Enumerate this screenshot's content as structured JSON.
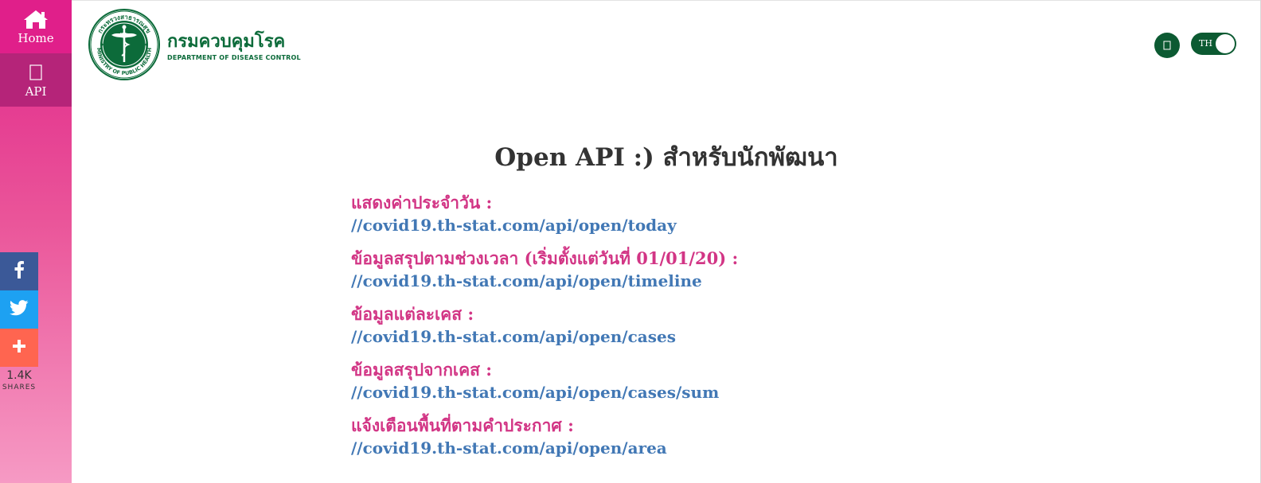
{
  "sidebar": {
    "items": [
      {
        "label": "Home",
        "icon": "home-icon"
      },
      {
        "label": "API",
        "icon": "code-icon"
      }
    ]
  },
  "header": {
    "logo": {
      "thai_name": "กรมควบคุมโรค",
      "english_name": "DEPARTMENT OF DISEASE CONTROL",
      "seal_text_top": "กระทรวงสาธารณสุข",
      "seal_text_bottom": "MINISTRY OF PUBLIC HEALTH"
    },
    "language_toggle": "TH"
  },
  "share": {
    "count": "1.4K",
    "label": "SHARES"
  },
  "main": {
    "title": "Open API :) สำหรับนักพัฒนา",
    "endpoints": [
      {
        "label": "แสดงค่าประจำวัน :",
        "url": "//covid19.th-stat.com/api/open/today"
      },
      {
        "label": "ข้อมูลสรุปตามช่วงเวลา (เริ่มตั้งแต่วันที่ 01/01/20) :",
        "url": "//covid19.th-stat.com/api/open/timeline"
      },
      {
        "label": "ข้อมูลแต่ละเคส :",
        "url": "//covid19.th-stat.com/api/open/cases"
      },
      {
        "label": "ข้อมูลสรุปจากเคส :",
        "url": "//covid19.th-stat.com/api/open/cases/sum"
      },
      {
        "label": "แจ้งเตือนพื้นที่ตามคำประกาศ :",
        "url": "//covid19.th-stat.com/api/open/area"
      }
    ]
  },
  "colors": {
    "sidebar_top": "#e0268a",
    "sidebar_active": "#b52479",
    "brand_green": "#0c6b3a",
    "label_pink": "#d23585",
    "link_blue": "#4278b5",
    "facebook": "#3b5998",
    "twitter": "#1da1f2",
    "share_more": "#ff6550"
  }
}
